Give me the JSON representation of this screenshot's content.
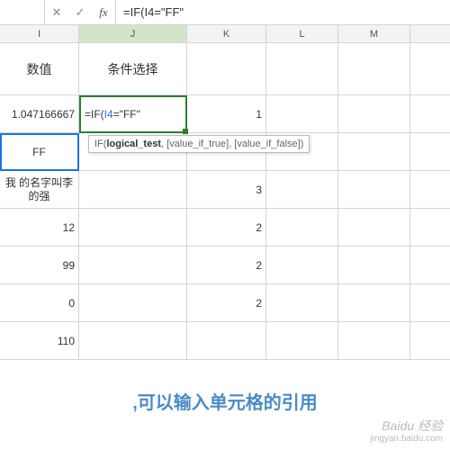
{
  "formula_bar": {
    "cancel": "✕",
    "confirm": "✓",
    "fx": "fx",
    "formula": "=IF(I4=\"FF\""
  },
  "columns": {
    "i": "I",
    "j": "J",
    "k": "K",
    "l": "L",
    "m": "M"
  },
  "cells": {
    "header_i": "数值",
    "header_j": "条件选择",
    "r4_i": "1.047166667",
    "r4_j_prefix": "=IF(",
    "r4_j_ref": "I4",
    "r4_j_suffix": "=\"FF\"",
    "r4_k": "1",
    "r5_i": "FF",
    "r6_i": "我     的名字叫李的强",
    "r6_k": "3",
    "r7_i": "12",
    "r7_k": "2",
    "r8_i": "99",
    "r8_k": "2",
    "r9_i": "0",
    "r9_k": "2",
    "r10_i": "110"
  },
  "tooltip": {
    "fn": "IF",
    "args": "(logical_test, [value_if_true], [value_if_false])"
  },
  "caption": ",可以输入单元格的引用",
  "watermark": {
    "brand": "Baidu 经验",
    "url": "jingyan.baidu.com"
  }
}
